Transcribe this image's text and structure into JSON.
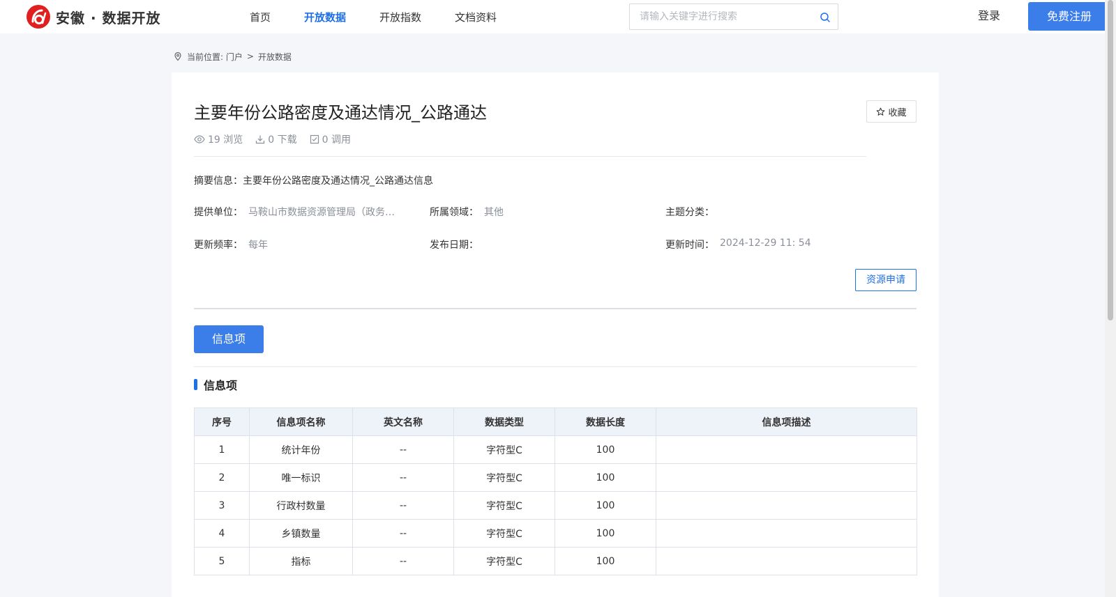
{
  "header": {
    "logo_text": "安徽 · 数据开放",
    "nav": [
      {
        "label": "首页",
        "active": false
      },
      {
        "label": "开放数据",
        "active": true
      },
      {
        "label": "开放指数",
        "active": false
      },
      {
        "label": "文档资料",
        "active": false
      }
    ],
    "search_placeholder": "请输入关键字进行搜索",
    "login_label": "登录",
    "register_label": "免费注册",
    "accent_color": "#1f6fe6",
    "logo_color": "#e02020"
  },
  "breadcrumb": {
    "prefix": "当前位置: 门户",
    "separator": ">",
    "current": "开放数据"
  },
  "dataset": {
    "title": "主要年份公路密度及通达情况_公路通达",
    "favorite_label": "收藏",
    "stats": {
      "views": "19 浏览",
      "downloads": "0 下载",
      "calls": "0 调用"
    },
    "summary": "摘要信息：主要年份公路密度及通达情况_公路通达信息",
    "meta": {
      "provider_label": "提供单位：",
      "provider_value": "马鞍山市数据资源管理局（政务服务管理局）",
      "domain_label": "所属领域：",
      "domain_value": "其他",
      "topic_label": "主题分类：",
      "topic_value": "",
      "frequency_label": "更新频率：",
      "frequency_value": "每年",
      "publish_label": "发布日期：",
      "publish_value": "",
      "updated_label": "更新时间：",
      "updated_value": "2024-12-29 11: 54"
    },
    "apply_label": "资源申请"
  },
  "tabs": {
    "active_label": "信息项"
  },
  "section": {
    "title": "信息项"
  },
  "table": {
    "headers": [
      "序号",
      "信息项名称",
      "英文名称",
      "数据类型",
      "数据长度",
      "信息项描述"
    ],
    "rows": [
      [
        "1",
        "统计年份",
        "--",
        "字符型C",
        "100",
        ""
      ],
      [
        "2",
        "唯一标识",
        "--",
        "字符型C",
        "100",
        ""
      ],
      [
        "3",
        "行政村数量",
        "--",
        "字符型C",
        "100",
        ""
      ],
      [
        "4",
        "乡镇数量",
        "--",
        "字符型C",
        "100",
        ""
      ],
      [
        "5",
        "指标",
        "--",
        "字符型C",
        "100",
        ""
      ]
    ]
  }
}
